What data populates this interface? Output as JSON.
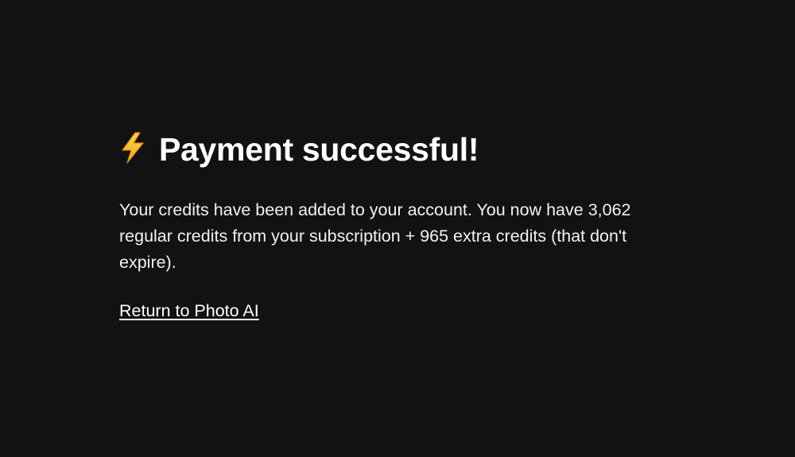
{
  "page": {
    "background": "#121212",
    "text_color": "#ffffff"
  },
  "header": {
    "icon": "lightning-bolt-icon",
    "title": "Payment successful!"
  },
  "message": {
    "text": "Your credits have been added to your account. You now have 3,062 regular credits from your subscription + 965 extra credits (that don't expire)."
  },
  "links": {
    "return_label": "Return to Photo AI"
  }
}
